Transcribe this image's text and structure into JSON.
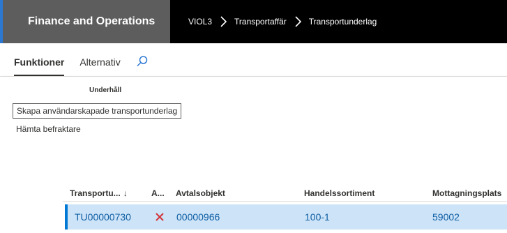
{
  "nav": {
    "app_title": "Finance and Operations",
    "breadcrumbs": [
      "VIOL3",
      "Transportaffär",
      "Transportunderlag"
    ]
  },
  "action_pane": {
    "tabs": [
      "Funktioner",
      "Alternativ"
    ],
    "search_icon": "search-icon"
  },
  "flyout": {
    "group_header": "Underhåll",
    "items": [
      "Skapa användarskapade transportunderlag",
      "Hämta befraktare"
    ]
  },
  "grid": {
    "columns": [
      "Transportu...",
      "A...",
      "Avtalsobjekt",
      "Handelssortiment",
      "Mottagningsplats"
    ],
    "sort_icon": "↓",
    "rows": [
      {
        "id": "TU00000730",
        "status_icon": "close-icon",
        "avtalsobjekt": "00000966",
        "handelssortiment": "100-1",
        "mottagningsplats": "59002"
      }
    ]
  },
  "colors": {
    "accent": "#0078d4",
    "status_x": "#d13438",
    "selected_row": "#cde3f8"
  }
}
